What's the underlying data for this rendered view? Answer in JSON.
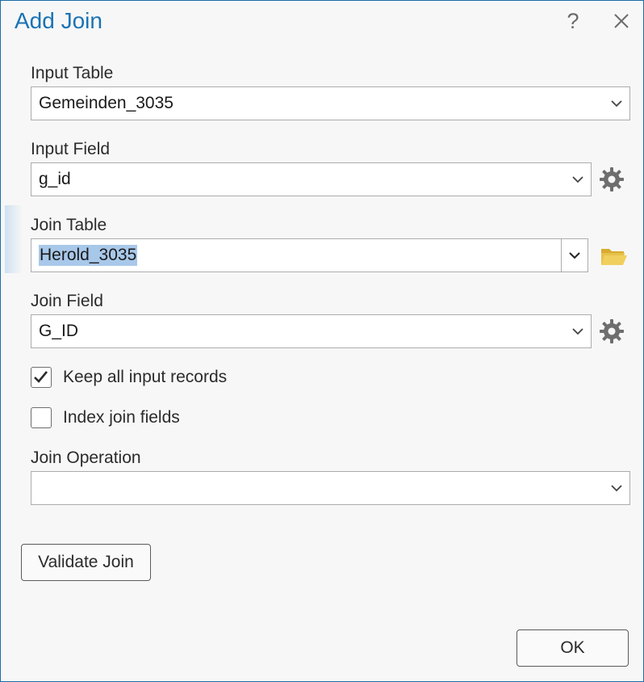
{
  "dialog": {
    "title": "Add Join",
    "help_glyph": "?",
    "help_icon": "help-icon",
    "close_icon": "close-icon"
  },
  "input_table": {
    "label": "Input Table",
    "value": "Gemeinden_3035"
  },
  "input_field": {
    "label": "Input Field",
    "value": "g_id",
    "icon": "gear-icon"
  },
  "join_table": {
    "label": "Join Table",
    "value": "Herold_3035",
    "icon": "folder-icon"
  },
  "join_field": {
    "label": "Join Field",
    "value": "G_ID",
    "icon": "gear-icon"
  },
  "keep_all": {
    "label": "Keep all input records",
    "checked": true
  },
  "index_fields": {
    "label": "Index join fields",
    "checked": false
  },
  "join_operation": {
    "label": "Join Operation",
    "value": ""
  },
  "buttons": {
    "validate": "Validate Join",
    "ok": "OK"
  },
  "colors": {
    "accent": "#1a73b5",
    "selection": "#a8c8ea",
    "folder": "#e6c04a"
  }
}
